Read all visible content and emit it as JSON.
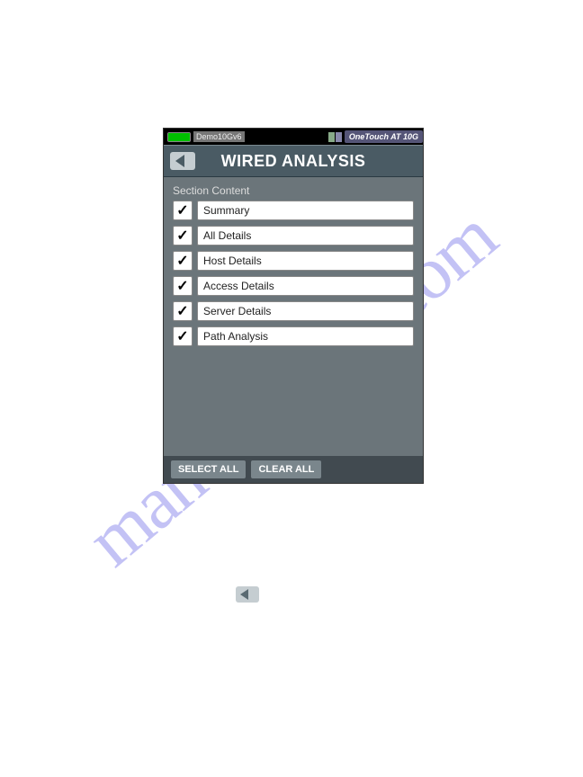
{
  "watermark": "manualshive.com",
  "statusBar": {
    "demoLabel": "Demo10Gv6",
    "deviceName": "OneTouch AT 10G"
  },
  "header": {
    "title": "WIRED ANALYSIS"
  },
  "sectionLabel": "Section Content",
  "items": [
    {
      "label": "Summary",
      "checked": true
    },
    {
      "label": "All Details",
      "checked": true
    },
    {
      "label": "Host Details",
      "checked": true
    },
    {
      "label": "Access Details",
      "checked": true
    },
    {
      "label": "Server Details",
      "checked": true
    },
    {
      "label": "Path Analysis",
      "checked": true
    }
  ],
  "actions": {
    "selectAll": "SELECT ALL",
    "clearAll": "CLEAR ALL"
  }
}
